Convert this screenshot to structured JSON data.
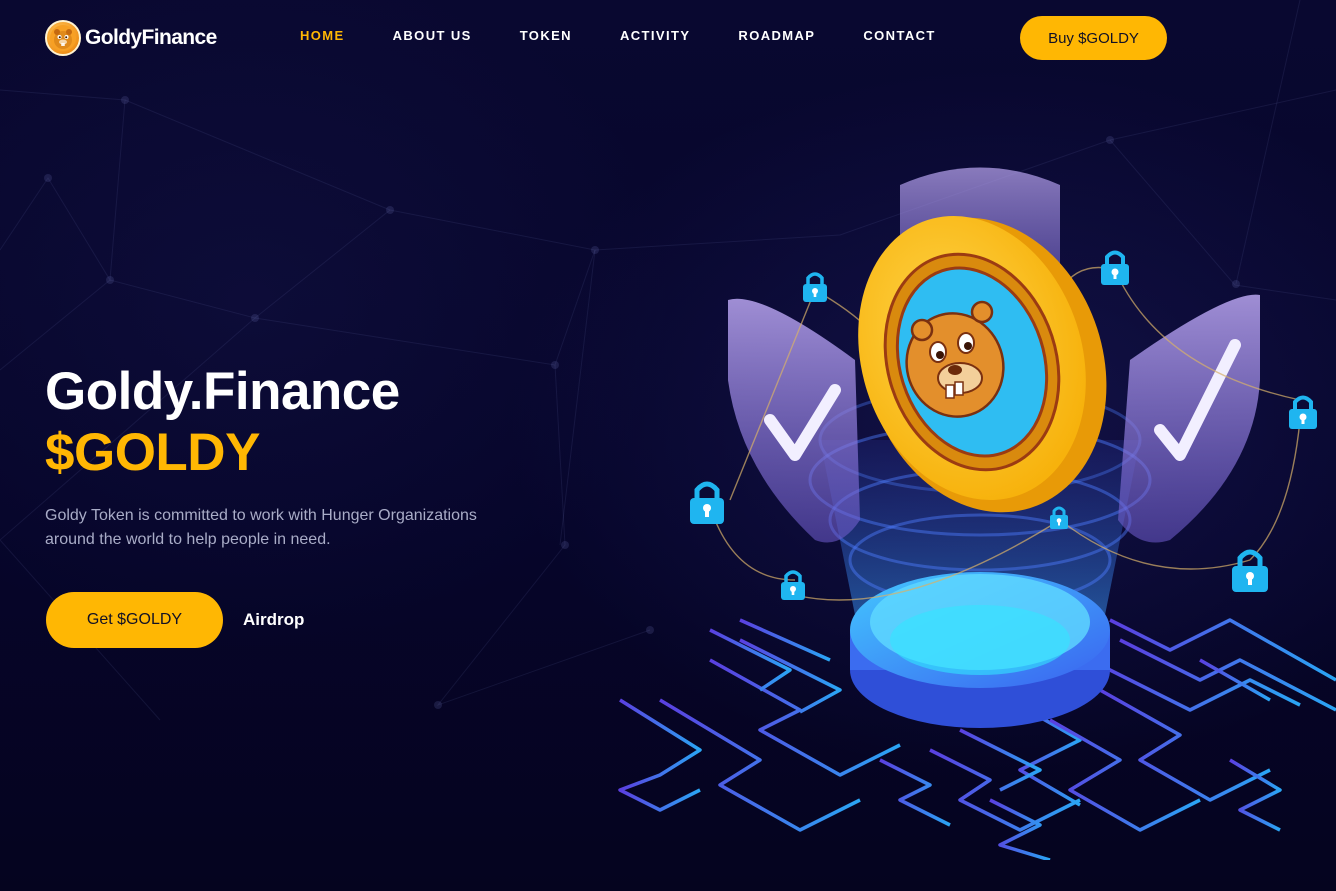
{
  "header": {
    "logo_text": "GoldyFinance",
    "nav": [
      {
        "label": "HOME",
        "active": true
      },
      {
        "label": "ABOUT US",
        "active": false
      },
      {
        "label": "TOKEN",
        "active": false
      },
      {
        "label": "ACTIVITY",
        "active": false
      },
      {
        "label": "ROADMAP",
        "active": false
      },
      {
        "label": "CONTACT",
        "active": false
      }
    ],
    "buy_label": "Buy $GOLDY"
  },
  "hero": {
    "title": "Goldy.Finance",
    "token": "$GOLDY",
    "description": "Goldy Token is committed to work with Hunger Organizations around the world to help people in need.",
    "primary_cta": "Get $GOLDY",
    "secondary_cta": "Airdrop"
  },
  "colors": {
    "accent": "#ffb703",
    "background": "#07062a",
    "text": "#ffffff",
    "muted_text": "#a9acc7",
    "circuit": "#4d5cf5",
    "lock": "#1fb5f0"
  },
  "icons": {
    "logo": "beaver-coin-icon",
    "coin": "beaver-coin-icon",
    "shield": "shield-check-icon",
    "lock": "padlock-icon"
  }
}
